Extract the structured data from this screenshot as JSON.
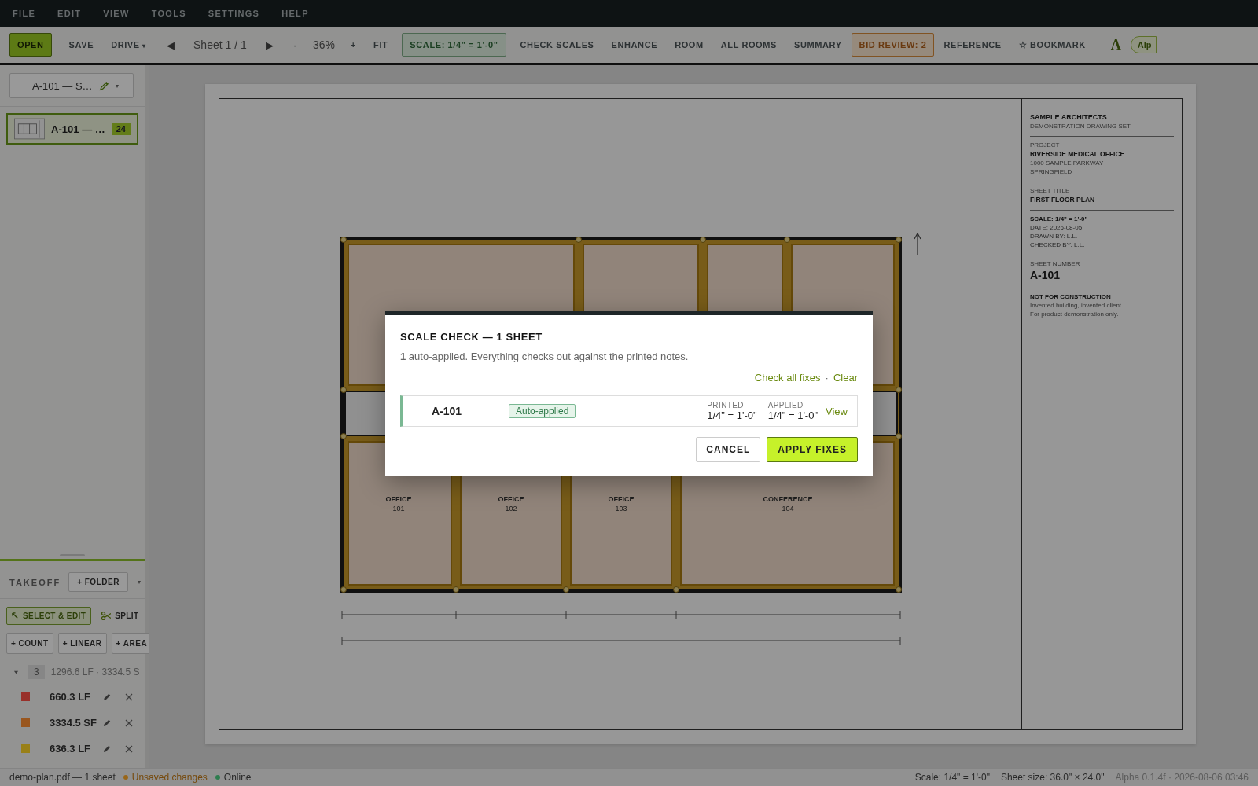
{
  "menu": [
    "FILE",
    "EDIT",
    "VIEW",
    "TOOLS",
    "SETTINGS",
    "HELP"
  ],
  "toolbar": [
    {
      "kind": "primary",
      "label": "OPEN"
    },
    {
      "kind": "plain",
      "label": "SAVE"
    },
    {
      "kind": "dropdown",
      "label": "DRIVE",
      "caret": "▾"
    },
    {
      "kind": "arrow",
      "label": "◀"
    },
    {
      "kind": "text",
      "label": "Sheet 1 / 1"
    },
    {
      "kind": "arrow",
      "label": "▶"
    },
    {
      "kind": "plain",
      "label": "-"
    },
    {
      "kind": "text",
      "label": "36%"
    },
    {
      "kind": "plain",
      "label": "+"
    },
    {
      "kind": "plain",
      "label": "FIT"
    },
    {
      "kind": "scale",
      "label": "SCALE: 1/4\" = 1'-0\""
    },
    {
      "kind": "plain",
      "label": "CHECK SCALES"
    },
    {
      "kind": "plain",
      "label": "ENHANCE"
    },
    {
      "kind": "plain",
      "label": "ROOM"
    },
    {
      "kind": "plain",
      "label": "ALL ROOMS"
    },
    {
      "kind": "plain",
      "label": "SUMMARY"
    },
    {
      "kind": "warning",
      "label": "BID REVIEW: 2"
    },
    {
      "kind": "plain",
      "label": "REFERENCE"
    },
    {
      "kind": "plain",
      "label": "☆ BOOKMARK"
    },
    {
      "kind": "logo",
      "label": "A"
    },
    {
      "kind": "pill",
      "label": "Alp"
    }
  ],
  "sidebar": {
    "sheet_select": {
      "label": "A-101 — S…",
      "caret": "▾"
    },
    "sheets": [
      {
        "label": "A-101 — …",
        "count": "24",
        "selected": true
      }
    ],
    "takeoff": {
      "title": "TAKEOFF",
      "folder": "+ FOLDER",
      "caret": "▾"
    },
    "tools": [
      {
        "kind": "select",
        "label": "SELECT & EDIT",
        "selected": true
      },
      {
        "kind": "split",
        "label": "SPLIT",
        "selected": false
      }
    ],
    "add_buttons": [
      "+ COUNT",
      "+ LINEAR",
      "+ AREA"
    ],
    "group": {
      "expanded": true,
      "count": "3",
      "summary": "1296.6 LF · 3334.5 S"
    },
    "items": [
      {
        "color": "#98302a",
        "value": "660.3 LF"
      },
      {
        "color": "#99561e",
        "value": "3334.5 SF"
      },
      {
        "color": "#998018",
        "value": "636.3 LF"
      }
    ]
  },
  "sheet": {
    "rooms": [
      {
        "name": "OFFICE",
        "number": "101"
      },
      {
        "name": "OFFICE",
        "number": "102"
      },
      {
        "name": "OFFICE",
        "number": "103"
      },
      {
        "name": "CONFERENCE",
        "number": "104"
      }
    ],
    "title_block": {
      "firm": "SAMPLE ARCHITECTS",
      "firm_note": "DEMONSTRATION DRAWING SET",
      "project_label": "PROJECT",
      "project": "RIVERSIDE MEDICAL OFFICE",
      "address": [
        "1000 SAMPLE PARKWAY",
        "SPRINGFIELD"
      ],
      "title_label": "SHEET TITLE",
      "title": "FIRST FLOOR PLAN",
      "scale": "SCALE:   1/4\" = 1'-0\"",
      "details": [
        "DATE:   2026-08-05",
        "DRAWN BY:   L.L.",
        "CHECKED BY:   L.L."
      ],
      "number_label": "SHEET NUMBER",
      "number": "A-101",
      "notice": "NOT FOR CONSTRUCTION",
      "notice_lines": [
        "Invented building, invented client.",
        "For product demonstration only."
      ]
    }
  },
  "dialog": {
    "title": "SCALE CHECK — 1 SHEET",
    "message": "**1** auto-applied. Everything checks out against the printed notes.",
    "links": [
      "Check all fixes",
      "Clear"
    ],
    "separator": "·",
    "rows": [
      {
        "sheet": "A-101",
        "status": "Auto-applied",
        "printed_label": "PRINTED",
        "printed": "1/4\" = 1'-0\"",
        "applied_label": "APPLIED",
        "applied": "1/4\" = 1'-0\"",
        "action": "View"
      }
    ],
    "buttons": [
      {
        "kind": "secondary",
        "label": "CANCEL"
      },
      {
        "kind": "primary",
        "label": "APPLY FIXES"
      }
    ]
  },
  "status_bar": {
    "file": "demo-plan.pdf — 1 sheet",
    "states": [
      {
        "label": "Unsaved changes",
        "color": "#99661a"
      },
      {
        "label": "Online",
        "color": "#2e7d4f"
      }
    ],
    "right": [
      "Scale: 1/4\" = 1'-0\"",
      "Sheet size: 36.0\" × 24.0\"",
      "Alpha 0.1.4f · 2026-08-06 03:46"
    ]
  }
}
